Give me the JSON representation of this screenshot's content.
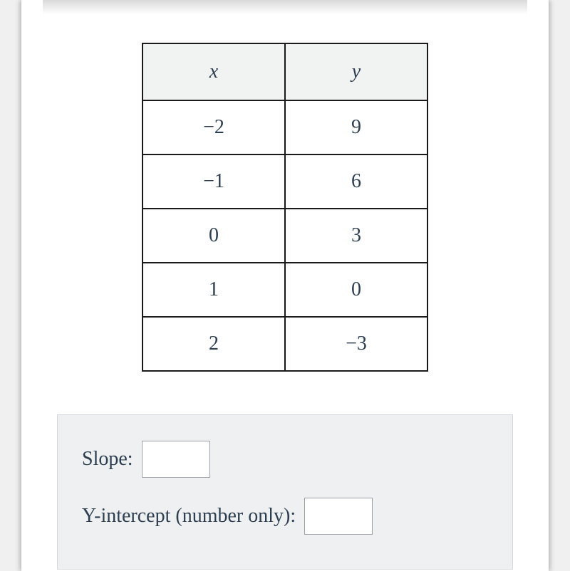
{
  "table": {
    "headers": {
      "x": "x",
      "y": "y"
    },
    "rows": [
      {
        "x": "−2",
        "y": "9"
      },
      {
        "x": "−1",
        "y": "6"
      },
      {
        "x": "0",
        "y": "3"
      },
      {
        "x": "1",
        "y": "0"
      },
      {
        "x": "2",
        "y": "−3"
      }
    ]
  },
  "fields": {
    "slope_label": "Slope:",
    "slope_value": "",
    "yint_label": "Y-intercept (number only):",
    "yint_value": ""
  }
}
